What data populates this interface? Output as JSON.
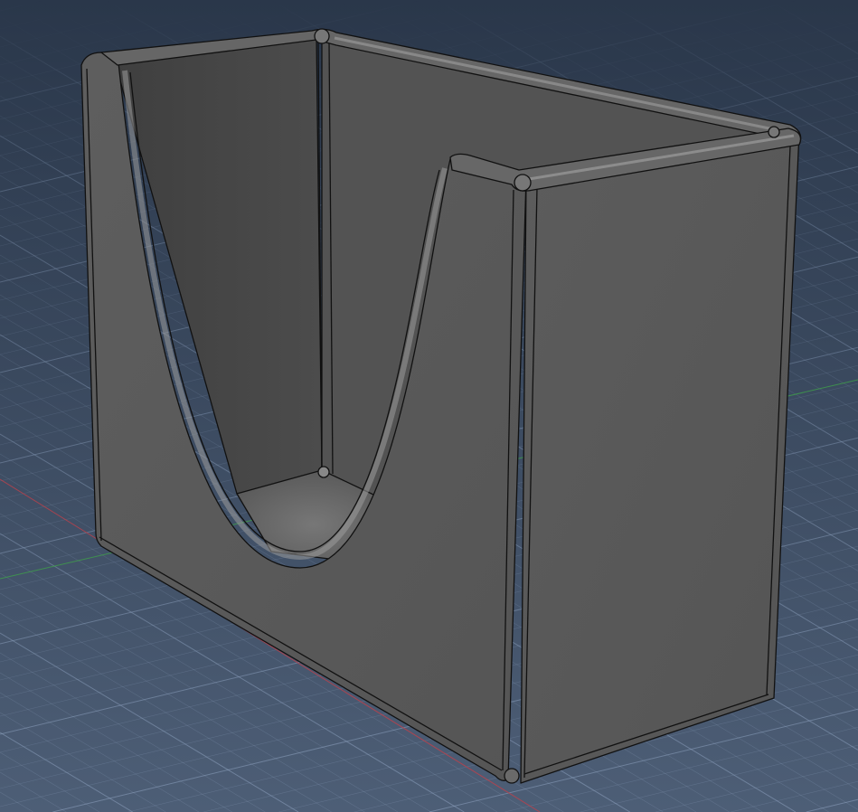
{
  "viewport": {
    "background_top": "#2a374a",
    "background_bottom": "#4d5e76",
    "grid_color": "#8fa3c0",
    "axis_x_color": "#c0404a",
    "axis_y_color": "#3fa04a"
  },
  "model": {
    "face_color": "#585858",
    "right_face_color": "#5a5a5a",
    "inner_back_color": "#484848",
    "inner_side_color": "#535353",
    "floor_color": "#686868",
    "edge_color": "#111111",
    "rim_highlight": "#9a9a9a"
  }
}
